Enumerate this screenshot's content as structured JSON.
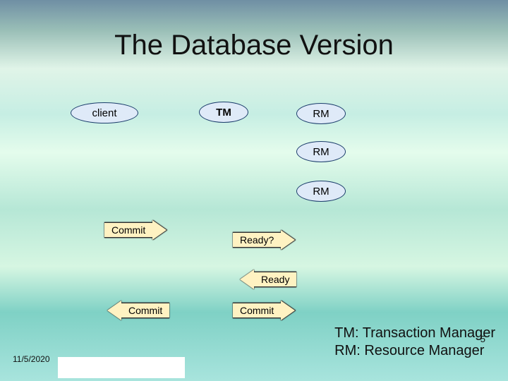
{
  "title": "The Database Version",
  "nodes": {
    "client": "client",
    "tm": "TM",
    "rm1": "RM",
    "rm2": "RM",
    "rm3": "RM"
  },
  "messages": {
    "commit1": "Commit",
    "ready_q": "Ready?",
    "ready": "Ready",
    "commit2": "Commit",
    "commit3": "Commit"
  },
  "legend": {
    "line1": "TM: Transaction Manager",
    "line2": "RM: Resource Manager"
  },
  "page_number": "5",
  "date": "11/5/2020"
}
